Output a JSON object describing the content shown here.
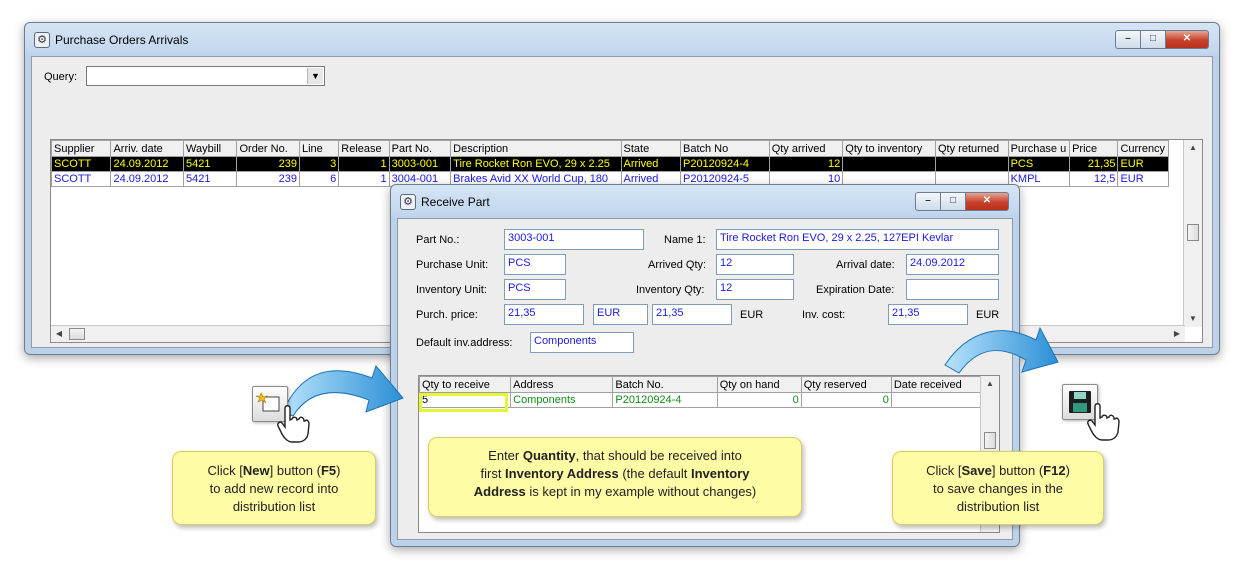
{
  "main_window": {
    "title": "Purchase Orders Arrivals",
    "query_label": "Query:",
    "query_value": "",
    "columns": [
      "Supplier",
      "Arriv. date",
      "Waybill",
      "Order No.",
      "Line",
      "Release",
      "Part No.",
      "Description",
      "State",
      "Batch No",
      "Qty arrived",
      "Qty to inventory",
      "Qty returned",
      "Purchase u",
      "Price",
      "Currency"
    ],
    "rows": [
      [
        "SCOTT",
        "24.09.2012",
        "5421",
        "239",
        "3",
        "1",
        "3003-001",
        "Tire Rocket Ron EVO, 29 x 2.25",
        "Arrived",
        "P20120924-4",
        "12",
        "",
        "",
        "PCS",
        "21,35",
        "EUR"
      ],
      [
        "SCOTT",
        "24.09.2012",
        "5421",
        "239",
        "6",
        "1",
        "3004-001",
        "Brakes Avid XX World Cup, 180",
        "Arrived",
        "P20120924-5",
        "10",
        "",
        "",
        "KMPL",
        "12,5",
        "EUR"
      ]
    ]
  },
  "receive_window": {
    "title": "Receive Part",
    "labels": {
      "part_no": "Part No.:",
      "name1": "Name 1:",
      "purchase_unit": "Purchase Unit:",
      "arrived_qty": "Arrived Qty:",
      "arrival_date": "Arrival date:",
      "inventory_unit": "Inventory Unit:",
      "inventory_qty": "Inventory Qty:",
      "expiration_date": "Expiration Date:",
      "purch_price": "Purch. price:",
      "eur": "EUR",
      "inv_cost": "Inv. cost:",
      "default_address": "Default inv.address:"
    },
    "values": {
      "part_no": "3003-001",
      "name1": "Tire Rocket Ron EVO, 29 x 2.25, 127EPI Kevlar",
      "purchase_unit": "PCS",
      "arrived_qty": "12",
      "arrival_date": "24.09.2012",
      "inventory_unit": "PCS",
      "inventory_qty": "12",
      "expiration_date": "",
      "purch_price": "21,35",
      "purch_currency": "EUR",
      "purch_price2": "21,35",
      "inv_cost": "21,35",
      "default_address": "Components"
    },
    "dist_columns": [
      "Qty to receive",
      "Address",
      "Batch No.",
      "Qty on hand",
      "Qty reserved",
      "Date received"
    ],
    "dist_rows": [
      [
        "5",
        "Components",
        "P20120924-4",
        "0",
        "0",
        ""
      ]
    ]
  },
  "callouts": {
    "new_btn": [
      "Click [",
      "New",
      "] button (",
      "F5",
      ")",
      "to add new record into",
      "distribution list"
    ],
    "qty": [
      "Enter ",
      "Quantity",
      ", that should be received into",
      "first ",
      "Inventory Address",
      " (the default ",
      "Inventory",
      "Address",
      " is kept in my example without changes)"
    ],
    "save_btn": [
      "Click [",
      "Save",
      "] button (",
      "F12",
      ")",
      "to save changes in the",
      "distribution list"
    ]
  },
  "colors": {
    "selected_row_bg": "#000000",
    "selected_row_fg": "#ffff00",
    "value_blue": "#1a1ae0",
    "value_green": "#138a13",
    "callout_bg": "#fffca6",
    "arrow_blue": "#3aa6e6"
  },
  "icons": {
    "app": "gear-icon",
    "new_button": "new-record-icon",
    "save_button": "floppy-disk-icon",
    "cursor": "hand-pointer-icon"
  }
}
